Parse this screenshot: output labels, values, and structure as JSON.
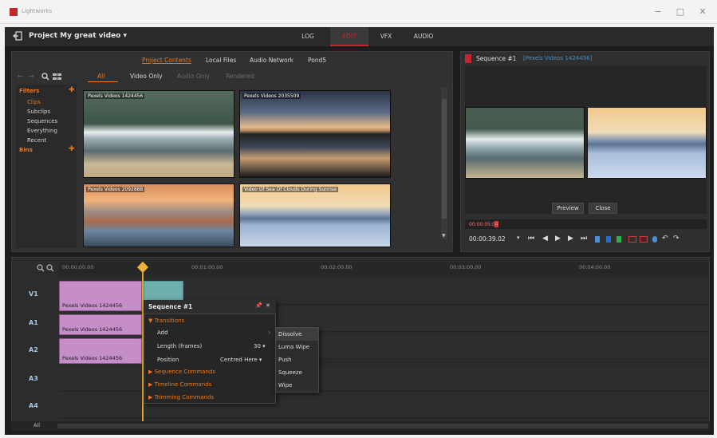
{
  "window": {
    "app_name": "Lightworks",
    "min_glyph": "−",
    "max_glyph": "□",
    "close_glyph": "✕"
  },
  "menubar": {
    "project": "Project My great video ▾",
    "tabs": [
      "LOG",
      "EDIT",
      "VFX",
      "AUDIO"
    ],
    "active_tab": "EDIT",
    "accent": "#c1272d"
  },
  "browser": {
    "source_tabs": [
      "Project Contents",
      "Local Files",
      "Audio Network",
      "Pond5"
    ],
    "filter_tabs": [
      "All",
      "Video Only",
      "Audio Only",
      "Rendered"
    ],
    "filters_title": "Filters",
    "filters": [
      "Clips",
      "Subclips",
      "Sequences",
      "Everything",
      "Recent"
    ],
    "bins_title": "Bins",
    "thumbs": [
      {
        "label": "Pexels Videos 1424456"
      },
      {
        "label": "Pexels Videos 2035509"
      },
      {
        "label": "Pexels Videos 2092888"
      },
      {
        "label": "Video Of Sea Of Clouds During Sunrise"
      }
    ]
  },
  "viewer": {
    "title": "Sequence #1",
    "subtitle": "[Pexels Videos 1424456]",
    "preview_button": "Preview",
    "close_button": "Close",
    "timecode_small": "00:00:05:04",
    "timecode": "00:00:39.02"
  },
  "timeline": {
    "ruler_marks": [
      "00:00:00.00",
      "00:01:00.00",
      "00:02:00.00",
      "00:03:00.00",
      "00:04:00.00"
    ],
    "tracks": [
      "V1",
      "A1",
      "A2",
      "A3",
      "A4"
    ],
    "bottom_label": "All",
    "clips": [
      {
        "label": "Pexels Videos 1424456"
      },
      {
        "label": "Pexels Videos 1424456"
      },
      {
        "label": "Pexels Videos 1424456"
      }
    ]
  },
  "context_menu": {
    "title": "Sequence #1",
    "pin": "📌",
    "close": "✕",
    "section": "Transitions",
    "add_label": "Add",
    "length_label": "Length (frames)",
    "length_value": "30 ▾",
    "position_label": "Position",
    "position_value": "Centred Here ▾",
    "groups": [
      "Sequence Commands",
      "Timeline Commands",
      "Trimming Commands"
    ],
    "submenu": [
      "Dissolve",
      "Luma Wipe",
      "Push",
      "Squeeze",
      "Wipe"
    ]
  }
}
